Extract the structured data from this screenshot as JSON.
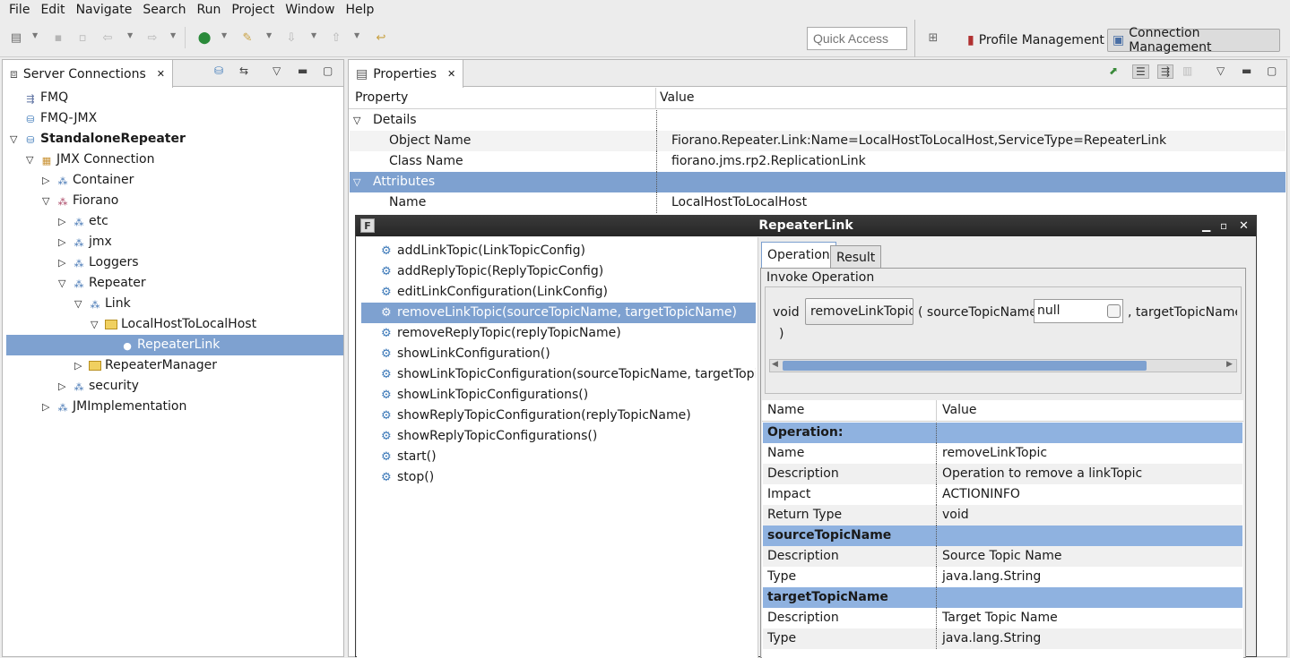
{
  "menu": [
    "File",
    "Edit",
    "Navigate",
    "Search",
    "Run",
    "Project",
    "Window",
    "Help"
  ],
  "toolbar": {
    "quick_access_placeholder": "Quick Access",
    "profile_management": "Profile Management",
    "connection_management": "Connection Management"
  },
  "server_connections": {
    "tab_label": "Server Connections",
    "tree": [
      {
        "label": "FMQ",
        "depth": 0,
        "twisty": "",
        "icon": "fmq",
        "bold": false,
        "selected": false
      },
      {
        "label": "FMQ-JMX",
        "depth": 0,
        "twisty": "",
        "icon": "server",
        "bold": false,
        "selected": false
      },
      {
        "label": "StandaloneRepeater",
        "depth": 0,
        "twisty": "open",
        "icon": "server",
        "bold": true,
        "selected": false
      },
      {
        "label": "JMX Connection",
        "depth": 1,
        "twisty": "open",
        "icon": "jmx",
        "bold": false,
        "selected": false
      },
      {
        "label": "Container",
        "depth": 2,
        "twisty": "closed",
        "icon": "mbean",
        "bold": false,
        "selected": false
      },
      {
        "label": "Fiorano",
        "depth": 2,
        "twisty": "open",
        "icon": "domain",
        "bold": false,
        "selected": false
      },
      {
        "label": "etc",
        "depth": 3,
        "twisty": "closed",
        "icon": "mbean",
        "bold": false,
        "selected": false
      },
      {
        "label": "jmx",
        "depth": 3,
        "twisty": "closed",
        "icon": "mbean",
        "bold": false,
        "selected": false
      },
      {
        "label": "Loggers",
        "depth": 3,
        "twisty": "closed",
        "icon": "mbean",
        "bold": false,
        "selected": false
      },
      {
        "label": "Repeater",
        "depth": 3,
        "twisty": "open",
        "icon": "mbean",
        "bold": false,
        "selected": false
      },
      {
        "label": "Link",
        "depth": 4,
        "twisty": "open",
        "icon": "mbean",
        "bold": false,
        "selected": false
      },
      {
        "label": "LocalHostToLocalHost",
        "depth": 5,
        "twisty": "open",
        "icon": "folder",
        "bold": false,
        "selected": false
      },
      {
        "label": "RepeaterLink",
        "depth": 6,
        "twisty": "",
        "icon": "bean",
        "bold": false,
        "selected": true
      },
      {
        "label": "RepeaterManager",
        "depth": 4,
        "twisty": "closed",
        "icon": "folder",
        "bold": false,
        "selected": false
      },
      {
        "label": "security",
        "depth": 3,
        "twisty": "closed",
        "icon": "mbean",
        "bold": false,
        "selected": false
      },
      {
        "label": "JMImplementation",
        "depth": 2,
        "twisty": "closed",
        "icon": "mbean",
        "bold": false,
        "selected": false
      }
    ]
  },
  "properties": {
    "tab_label": "Properties",
    "col_property": "Property",
    "col_value": "Value",
    "rows": [
      {
        "type": "group",
        "label": "Details",
        "value": "",
        "selected": false
      },
      {
        "type": "item",
        "label": "Object Name",
        "value": "Fiorano.Repeater.Link:Name=LocalHostToLocalHost,ServiceType=RepeaterLink",
        "selected": false
      },
      {
        "type": "item",
        "label": "Class Name",
        "value": "fiorano.jms.rp2.ReplicationLink",
        "selected": false
      },
      {
        "type": "group",
        "label": "Attributes",
        "value": "",
        "selected": true
      },
      {
        "type": "item",
        "label": "Name",
        "value": "LocalHostToLocalHost",
        "selected": false
      }
    ]
  },
  "dialog": {
    "title": "RepeaterLink",
    "operations": [
      "addLinkTopic(LinkTopicConfig)",
      "addReplyTopic(ReplyTopicConfig)",
      "editLinkConfiguration(LinkConfig)",
      "removeLinkTopic(sourceTopicName, targetTopicName)",
      "removeReplyTopic(replyTopicName)",
      "showLinkConfiguration()",
      "showLinkTopicConfiguration(sourceTopicName, targetTopicNar",
      "showLinkTopicConfigurations()",
      "showReplyTopicConfiguration(replyTopicName)",
      "showReplyTopicConfigurations()",
      "start()",
      "stop()"
    ],
    "selected_operation_index": 3,
    "tabs": {
      "operation": "Operation",
      "result": "Result"
    },
    "invoke": {
      "legend": "Invoke Operation",
      "return_type": "void",
      "button": "removeLinkTopic",
      "open_paren": "( sourceTopicName",
      "source_value": "null",
      "target_label": ", targetTopicName",
      "close_paren": ")"
    },
    "details": {
      "col_name": "Name",
      "col_value": "Value",
      "rows": [
        {
          "type": "header",
          "name": "Operation:",
          "value": ""
        },
        {
          "type": "item",
          "name": "Name",
          "value": "removeLinkTopic"
        },
        {
          "type": "item",
          "name": "Description",
          "value": "Operation to remove a linkTopic"
        },
        {
          "type": "item",
          "name": "Impact",
          "value": "ACTIONINFO"
        },
        {
          "type": "item",
          "name": "Return Type",
          "value": "void"
        },
        {
          "type": "header",
          "name": "sourceTopicName",
          "value": ""
        },
        {
          "type": "item",
          "name": "Description",
          "value": "Source Topic Name"
        },
        {
          "type": "item",
          "name": "Type",
          "value": "java.lang.String"
        },
        {
          "type": "header",
          "name": "targetTopicName",
          "value": ""
        },
        {
          "type": "item",
          "name": "Description",
          "value": "Target Topic Name"
        },
        {
          "type": "item",
          "name": "Type",
          "value": "java.lang.String"
        }
      ]
    }
  }
}
